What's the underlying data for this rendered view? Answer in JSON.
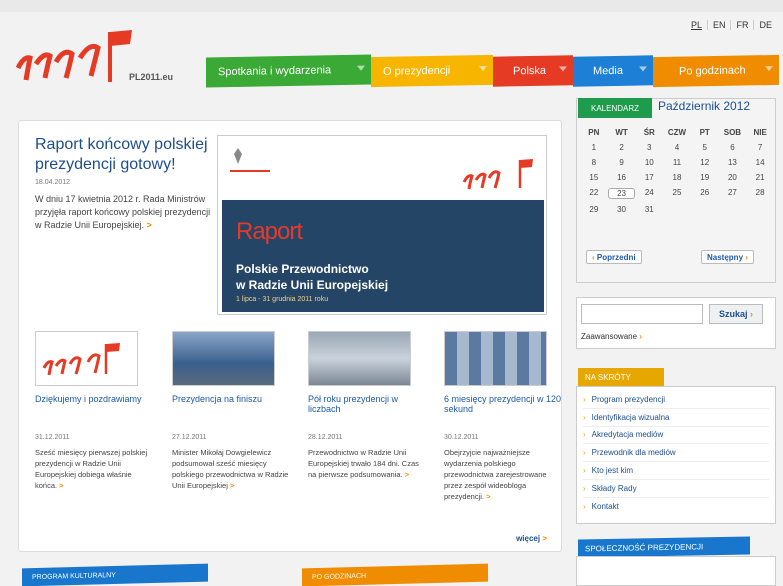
{
  "languages": [
    "PL",
    "EN",
    "FR",
    "DE"
  ],
  "logo": {
    "text": "PL2011.eu"
  },
  "nav": [
    {
      "label": "Spotkania i wydarzenia",
      "color": "#3aa935"
    },
    {
      "label": "O prezydencji",
      "color": "#f7b500"
    },
    {
      "label": "Polska",
      "color": "#e53a24"
    },
    {
      "label": "Media",
      "color": "#1d7fd6"
    },
    {
      "label": "Po godzinach",
      "color": "#f08c00"
    }
  ],
  "hero": {
    "title": "Raport końcowy polskiej prezydencji gotowy!",
    "date": "18.04.2012",
    "text": "W dniu 17 kwietnia 2012 r. Rada Ministrów przyjęła raport końcowy polskiej prezydencji w Radzie Unii Europejskiej.",
    "arrow": ">",
    "image": {
      "word": "Raport",
      "line1": "Polskie Przewodnictwo",
      "line2": "w Radzie Unii Europejskiej",
      "line3": "1 lipca - 31 grudnia 2011 roku"
    }
  },
  "cards": [
    {
      "title": "Dziękujemy i pozdrawiamy",
      "date": "31.12.2011",
      "text": "Sześć miesięcy pierwszej polskiej prezydencji w Radzie Unii Europejskiej dobiega właśnie końca."
    },
    {
      "title": "Prezydencja na finiszu",
      "date": "27.12.2011",
      "text": "Minister Mikołaj Dowgielewicz podsumował sześć miesięcy polskiego przewodnictwa w Radzie Unii Europejskiej"
    },
    {
      "title": "Pół roku prezydencji w liczbach",
      "date": "28.12.2011",
      "text": "Przewodnictwo w Radzie Unii Europejskiej trwało 184 dni. Czas na pierwsze podsumowania."
    },
    {
      "title": "6 miesięcy prezydencji w 120 sekund",
      "date": "30.12.2011",
      "text": "Obejrzyjcie najważniejsze wydarzenia polskiego przewodnictwa zarejestrowane przez zespół wideobloga prezydencji."
    }
  ],
  "more": "więcej",
  "calendar": {
    "tab": "KALENDARZ",
    "month": "Październik 2012",
    "days": [
      "PN",
      "WT",
      "ŚR",
      "CZW",
      "PT",
      "SOB",
      "NIE"
    ],
    "dates": [
      "1",
      "2",
      "3",
      "4",
      "5",
      "6",
      "7",
      "8",
      "9",
      "10",
      "11",
      "12",
      "13",
      "14",
      "15",
      "16",
      "17",
      "18",
      "19",
      "20",
      "21",
      "22",
      "23",
      "24",
      "25",
      "26",
      "27",
      "28",
      "29",
      "30",
      "31"
    ],
    "today": "23",
    "prev": "Poprzedni",
    "next": "Następny"
  },
  "search": {
    "button": "Szukaj",
    "advanced": "Zaawansowane"
  },
  "shortcuts": {
    "tab": "NA SKRÓTY",
    "items": [
      "Program prezydencji",
      "Identyfikacja wizualna",
      "Akredytacja mediów",
      "Przewodnik dla mediów",
      "Kto jest kim",
      "Składy Rady",
      "Kontakt"
    ]
  },
  "community": {
    "tab": "SPOŁECZNOŚĆ PREZYDENCJI"
  },
  "bottom_tabs": [
    "PROGRAM KULTURALNY",
    "PO GODZINACH"
  ]
}
